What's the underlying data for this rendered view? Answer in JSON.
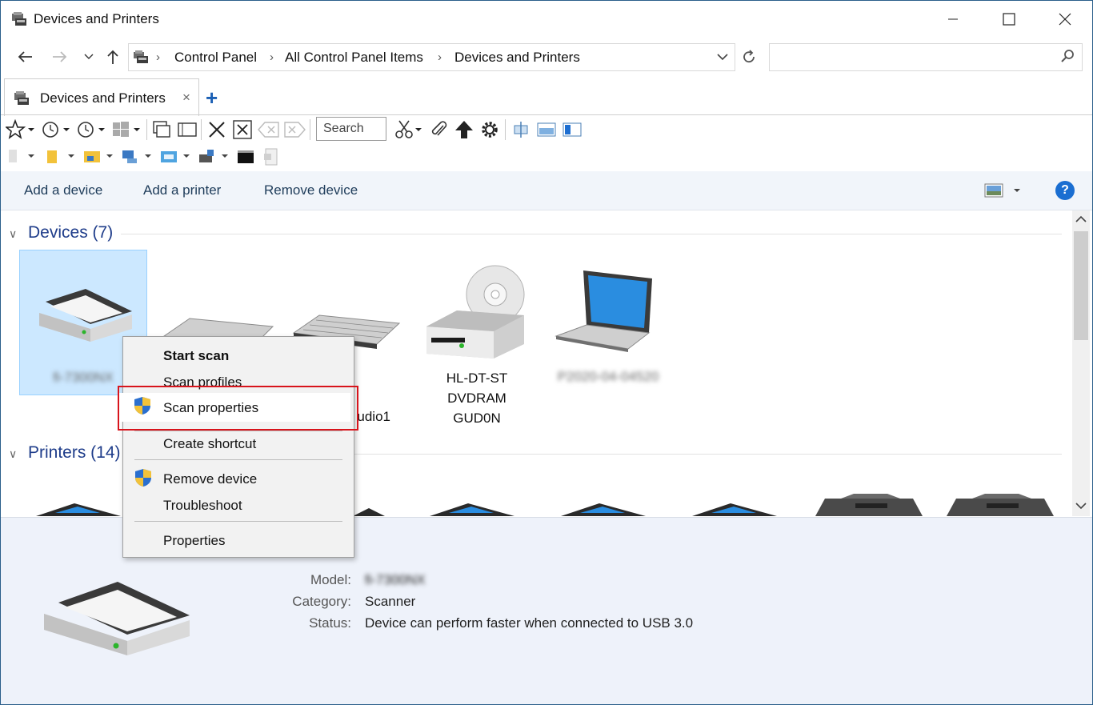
{
  "window": {
    "title": "Devices and Printers"
  },
  "address": {
    "crumbs": [
      "Control Panel",
      "All Control Panel Items",
      "Devices and Printers"
    ],
    "search_placeholder": ""
  },
  "tab": {
    "label": "Devices and Printers",
    "close": "×",
    "add": "+"
  },
  "toolbar": {
    "search_label": "Search"
  },
  "commands": {
    "add_device": "Add a device",
    "add_printer": "Add a printer",
    "remove_device": "Remove device",
    "help": "?"
  },
  "groups": {
    "devices": {
      "title": "Devices (7)"
    },
    "printers": {
      "title": "Printers (14)"
    }
  },
  "devices": [
    {
      "name": "fi-7300NX",
      "icon": "scanner-icon",
      "blurred": true,
      "selected": true
    },
    {
      "name": "",
      "icon": "keyboard-icon"
    },
    {
      "name": "udio1",
      "icon": "keyboard-icon"
    },
    {
      "name": "HL-DT-ST DVDRAM GUD0N",
      "icon": "dvd-drive-icon",
      "lines": [
        "HL-DT-ST",
        "DVDRAM",
        "GUD0N"
      ]
    },
    {
      "name": "P2020-04-04520",
      "icon": "laptop-icon",
      "blurred": true
    }
  ],
  "context_menu": {
    "items": [
      {
        "label": "Start scan",
        "bold": true
      },
      {
        "label": "Scan profiles"
      },
      {
        "label": "Scan properties",
        "shield": true,
        "highlighted": true
      },
      {
        "label": "Create shortcut"
      },
      {
        "label": "Remove device",
        "shield": true
      },
      {
        "label": "Troubleshoot"
      },
      {
        "label": "Properties"
      }
    ]
  },
  "details": {
    "model_label": "Model:",
    "model_value": "fi-7300NX",
    "category_label": "Category:",
    "category_value": "Scanner",
    "status_label": "Status:",
    "status_value": "Device can perform faster when connected to USB 3.0"
  },
  "colors": {
    "highlight_border": "#d8141c",
    "selection": "#cce8ff",
    "link": "#1e3c8a"
  }
}
